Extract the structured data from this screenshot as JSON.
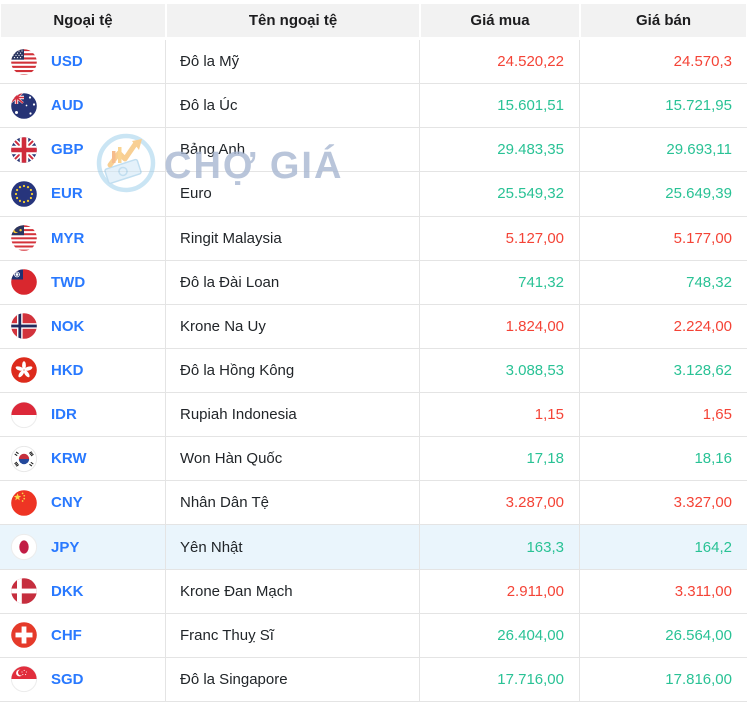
{
  "colors": {
    "code_blue": "#2979ff",
    "up_green": "#29c295",
    "down_red": "#f44336",
    "header_bg": "#f2f2f2",
    "border": "#e4e4e4",
    "highlight_bg": "#eaf5fc"
  },
  "watermark": {
    "text": "CHỢ GIÁ",
    "logo_icon": "cho-gia-logo-icon"
  },
  "table": {
    "columns": [
      {
        "key": "currency",
        "label": "Ngoại tệ"
      },
      {
        "key": "name",
        "label": "Tên ngoại tệ"
      },
      {
        "key": "buy",
        "label": "Giá mua"
      },
      {
        "key": "sell",
        "label": "Giá bán"
      }
    ],
    "rows": [
      {
        "code": "USD",
        "flag": "us",
        "flag_icon": "flag-usd-icon",
        "name": "Đô la Mỹ",
        "buy": "24.520,22",
        "sell": "24.570,3",
        "buy_trend": "down",
        "sell_trend": "down",
        "highlight": false
      },
      {
        "code": "AUD",
        "flag": "au",
        "flag_icon": "flag-aud-icon",
        "name": "Đô la Úc",
        "buy": "15.601,51",
        "sell": "15.721,95",
        "buy_trend": "up",
        "sell_trend": "up",
        "highlight": false
      },
      {
        "code": "GBP",
        "flag": "gb",
        "flag_icon": "flag-gbp-icon",
        "name": "Bảng Anh",
        "buy": "29.483,35",
        "sell": "29.693,11",
        "buy_trend": "up",
        "sell_trend": "up",
        "highlight": false
      },
      {
        "code": "EUR",
        "flag": "eu",
        "flag_icon": "flag-eur-icon",
        "name": "Euro",
        "buy": "25.549,32",
        "sell": "25.649,39",
        "buy_trend": "up",
        "sell_trend": "up",
        "highlight": false
      },
      {
        "code": "MYR",
        "flag": "my",
        "flag_icon": "flag-myr-icon",
        "name": "Ringit Malaysia",
        "buy": "5.127,00",
        "sell": "5.177,00",
        "buy_trend": "down",
        "sell_trend": "down",
        "highlight": false
      },
      {
        "code": "TWD",
        "flag": "tw",
        "flag_icon": "flag-twd-icon",
        "name": "Đô la Đài Loan",
        "buy": "741,32",
        "sell": "748,32",
        "buy_trend": "up",
        "sell_trend": "up",
        "highlight": false
      },
      {
        "code": "NOK",
        "flag": "no",
        "flag_icon": "flag-nok-icon",
        "name": "Krone Na Uy",
        "buy": "1.824,00",
        "sell": "2.224,00",
        "buy_trend": "down",
        "sell_trend": "down",
        "highlight": false
      },
      {
        "code": "HKD",
        "flag": "hk",
        "flag_icon": "flag-hkd-icon",
        "name": "Đô la Hồng Kông",
        "buy": "3.088,53",
        "sell": "3.128,62",
        "buy_trend": "up",
        "sell_trend": "up",
        "highlight": false
      },
      {
        "code": "IDR",
        "flag": "id",
        "flag_icon": "flag-idr-icon",
        "name": "Rupiah Indonesia",
        "buy": "1,15",
        "sell": "1,65",
        "buy_trend": "down",
        "sell_trend": "down",
        "highlight": false
      },
      {
        "code": "KRW",
        "flag": "kr",
        "flag_icon": "flag-krw-icon",
        "name": "Won Hàn Quốc",
        "buy": "17,18",
        "sell": "18,16",
        "buy_trend": "up",
        "sell_trend": "up",
        "highlight": false
      },
      {
        "code": "CNY",
        "flag": "cn",
        "flag_icon": "flag-cny-icon",
        "name": "Nhân Dân Tệ",
        "buy": "3.287,00",
        "sell": "3.327,00",
        "buy_trend": "down",
        "sell_trend": "down",
        "highlight": false
      },
      {
        "code": "JPY",
        "flag": "jp",
        "flag_icon": "flag-jpy-icon",
        "name": "Yên Nhật",
        "buy": "163,3",
        "sell": "164,2",
        "buy_trend": "up",
        "sell_trend": "up",
        "highlight": true
      },
      {
        "code": "DKK",
        "flag": "dk",
        "flag_icon": "flag-dkk-icon",
        "name": "Krone Đan Mạch",
        "buy": "2.911,00",
        "sell": "3.311,00",
        "buy_trend": "down",
        "sell_trend": "down",
        "highlight": false
      },
      {
        "code": "CHF",
        "flag": "ch",
        "flag_icon": "flag-chf-icon",
        "name": "Franc Thuỵ Sĩ",
        "buy": "26.404,00",
        "sell": "26.564,00",
        "buy_trend": "up",
        "sell_trend": "up",
        "highlight": false
      },
      {
        "code": "SGD",
        "flag": "sg",
        "flag_icon": "flag-sgd-icon",
        "name": "Đô la Singapore",
        "buy": "17.716,00",
        "sell": "17.816,00",
        "buy_trend": "up",
        "sell_trend": "up",
        "highlight": false
      }
    ]
  }
}
